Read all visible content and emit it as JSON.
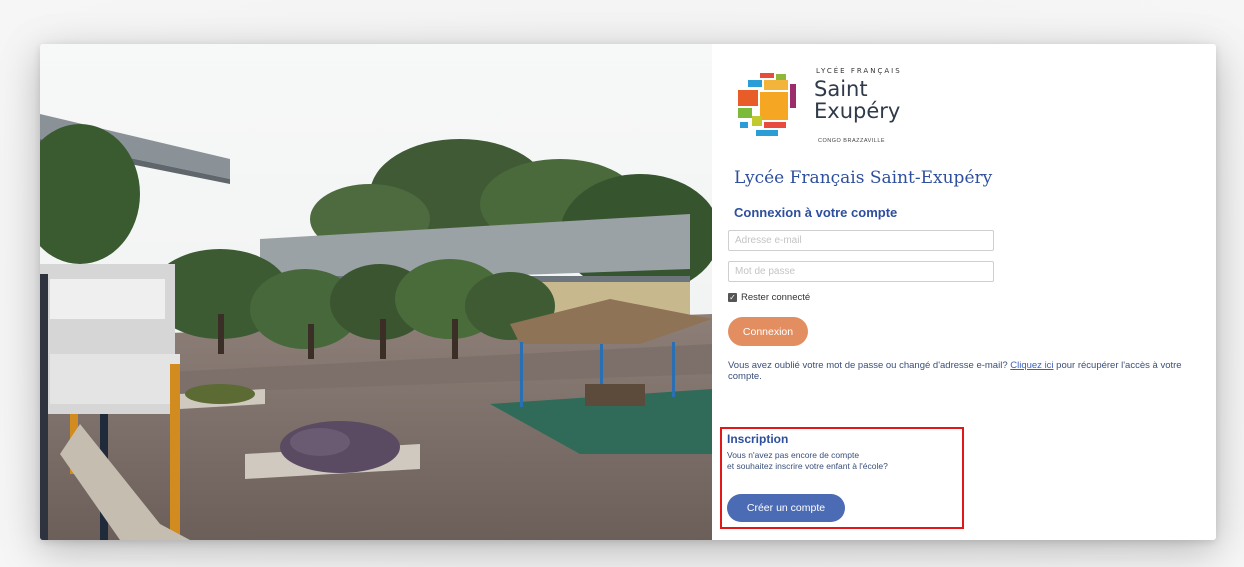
{
  "logo": {
    "top_text": "LYCÉE FRANÇAIS",
    "name_line1": "Saint",
    "name_line2": "Exupéry",
    "subtitle": "CONGO BRAZZAVILLE"
  },
  "panel": {
    "school_name": "Lycée Français Saint-Exupéry",
    "login_heading": "Connexion à votre compte"
  },
  "form": {
    "email_placeholder": "Adresse e-mail",
    "email_value": "",
    "password_placeholder": "Mot de passe",
    "password_value": "",
    "remember_label": "Rester connecté",
    "remember_checked": true,
    "login_button": "Connexion"
  },
  "forgot": {
    "text_before": "Vous avez oublié votre mot de passe ou changé d'adresse e-mail? ",
    "link": "Cliquez ici",
    "text_after": " pour récupérer l'accès à votre compte."
  },
  "signup": {
    "title": "Inscription",
    "line1": "Vous n'avez pas encore de compte",
    "line2": "et souhaitez inscrire votre enfant à l'école?",
    "button": "Créer un compte",
    "highlight_color": "#e01818"
  },
  "colors": {
    "accent_blue": "#2e4f9e",
    "login_button": "#e38e60",
    "signup_button": "#4c6bb5"
  },
  "icons": {
    "photo": "school-courtyard-photo",
    "logo": "school-logo-icon",
    "checkbox": "checkbox-checked-icon"
  }
}
